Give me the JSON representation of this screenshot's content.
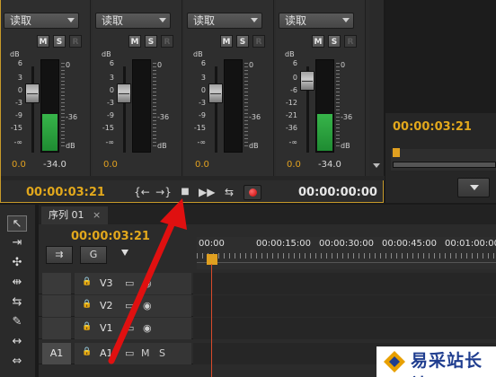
{
  "mixer": {
    "channels": [
      {
        "mode": "读取",
        "buttons": [
          "M",
          "S",
          "R"
        ],
        "db_unit": "dB",
        "left_scale": [
          "6",
          "3",
          "0",
          "-3",
          "-9",
          "-15",
          "-∞"
        ],
        "right_scale": [
          "0",
          "-36"
        ],
        "meter_unit": "dB",
        "left_value": "0.0",
        "right_value": "-34.0",
        "meter_level": 0.4,
        "fader_level": 0.2
      },
      {
        "mode": "读取",
        "buttons": [
          "M",
          "S",
          "R"
        ],
        "db_unit": "dB",
        "left_scale": [
          "6",
          "3",
          "0",
          "-3",
          "-9",
          "-15",
          "-∞"
        ],
        "right_scale": [
          "0",
          "-36"
        ],
        "meter_unit": "dB",
        "left_value": "0.0",
        "right_value": "",
        "meter_level": 0,
        "fader_level": 0.2
      },
      {
        "mode": "读取",
        "buttons": [
          "M",
          "S",
          "R"
        ],
        "db_unit": "dB",
        "left_scale": [
          "6",
          "3",
          "0",
          "-3",
          "-9",
          "-15",
          "-∞"
        ],
        "right_scale": [
          "0",
          "-36"
        ],
        "meter_unit": "dB",
        "left_value": "0.0",
        "right_value": "",
        "meter_level": 0,
        "fader_level": 0.2
      },
      {
        "mode": "读取",
        "buttons": [
          "M",
          "S",
          "R"
        ],
        "db_unit": "dB",
        "left_scale": [
          "6",
          "0",
          "-6",
          "-12",
          "-21",
          "-36",
          "-∞"
        ],
        "right_scale": [
          "0",
          "-36"
        ],
        "meter_unit": "dB",
        "left_value": "0.0",
        "right_value": "-34.0",
        "meter_level": 0.4,
        "fader_level": 0.05
      }
    ],
    "timecode_current": "00:00:03:21",
    "timecode_duration": "00:00:00:00",
    "transport": {
      "go_in": "{←",
      "go_out": "→}",
      "stop": "■",
      "play_in_out": "▶▶",
      "loop": "⇆"
    }
  },
  "monitor": {
    "timecode": "00:00:03:21"
  },
  "tools": [
    "selection-tool",
    "track-select-tool",
    "ripple-edit-tool",
    "rolling-edit-tool",
    "rate-stretch-tool",
    "razor-tool",
    "slip-tool",
    "slide-tool"
  ],
  "tool_glyphs": [
    "↖",
    "⇥",
    "✣",
    "⇹",
    "⇆",
    "✎",
    "↔",
    "⇔"
  ],
  "sequence": {
    "tab_label": "序列 01",
    "close": "×",
    "timecode": "00:00:03:21",
    "ruler": [
      "00:00",
      "00:00:15:00",
      "00:00:30:00",
      "00:00:45:00",
      "00:01:00:00"
    ],
    "header_buttons": [
      "⇉",
      "G"
    ],
    "tracks": [
      {
        "name": "V3",
        "type": "video",
        "lock": "🔒"
      },
      {
        "name": "V2",
        "type": "video",
        "lock": "🔒"
      },
      {
        "name": "V1",
        "type": "video",
        "lock": "🔒"
      },
      {
        "name": "A1",
        "type": "audio",
        "source_badge": "A1",
        "lock": "🔒",
        "mute": "M",
        "solo": "S"
      }
    ]
  },
  "colors": {
    "accent": "#e2a81c",
    "meter_green": "#2fa544",
    "playhead": "#d84a2a",
    "record": "#d40000",
    "annotation_arrow": "#e01010"
  },
  "watermark": {
    "text": "易采站长站"
  }
}
